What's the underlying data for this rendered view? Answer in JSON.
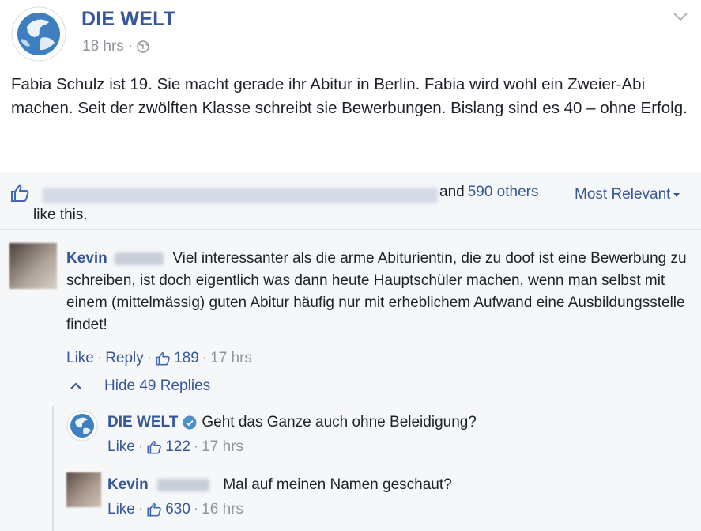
{
  "post": {
    "page_name": "DIE WELT",
    "time": "18 hrs",
    "separator": "·",
    "audience_icon": "globe-icon",
    "text": "Fabia Schulz ist 19. Sie macht gerade ihr Abitur in Berlin. Fabia wird wohl ein Zweier-Abi machen. Seit der zwölften Klasse schreibt sie Bewerbungen. Bislang sind es 40 – ohne Erfolg."
  },
  "likes": {
    "and_text": "and",
    "others_link": "590 others",
    "like_this": "like this.",
    "sort_label": "Most Relevant"
  },
  "comments": [
    {
      "author": "Kevin",
      "text": "Viel interessanter als die arme Abiturientin, die zu doof ist eine Bewerbung zu schreiben, ist doch eigentlich was dann heute Hauptschüler machen, wenn man selbst mit einem (mittelmässig) guten Abitur häufig nur mit erheblichem Aufwand eine Ausbildungsstelle findet!",
      "like_label": "Like",
      "reply_label": "Reply",
      "likes": "189",
      "time": "17 hrs"
    }
  ],
  "replies_toggle": "Hide 49 Replies",
  "replies": [
    {
      "author": "DIE WELT",
      "text": "Geht das Ganze auch ohne Beleidigung?",
      "like_label": "Like",
      "likes": "122",
      "time": "17 hrs"
    },
    {
      "author": "Kevin",
      "text": "Mal auf meinen Namen geschaut?",
      "like_label": "Like",
      "likes": "630",
      "time": "16 hrs"
    }
  ],
  "colors": {
    "link": "#365899",
    "muted": "#90949c",
    "feedback_bg": "#f6f7f9",
    "brand_blue": "#4a90c9"
  }
}
